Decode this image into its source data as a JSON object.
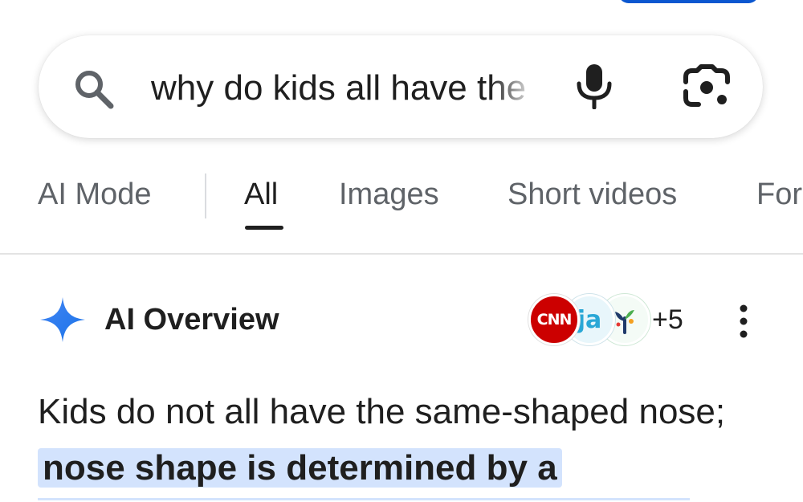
{
  "search": {
    "query": "why do kids all have the same shaped nose"
  },
  "tabs": [
    {
      "label": "AI Mode"
    },
    {
      "label": "All"
    },
    {
      "label": "Images"
    },
    {
      "label": "Short videos"
    },
    {
      "label": "Forums"
    }
  ],
  "active_tab": "All",
  "ai_overview": {
    "title": "AI Overview",
    "sources": [
      {
        "label": "CNN"
      },
      {
        "label": "ja"
      },
      {
        "label": "tree-logo"
      }
    ],
    "more_sources": "+5",
    "answer_plain": "Kids do not all have the same-shaped nose; ",
    "answer_highlight": "nose shape is determined by a"
  },
  "colors": {
    "accent_blue": "#0b57d0",
    "highlight": "#d3e3fd",
    "text": "#1f1f1f",
    "muted": "#5f6368"
  },
  "icons": [
    "search-icon",
    "microphone-icon",
    "google-lens-icon",
    "ai-sparkle-icon",
    "more-vert-icon"
  ]
}
